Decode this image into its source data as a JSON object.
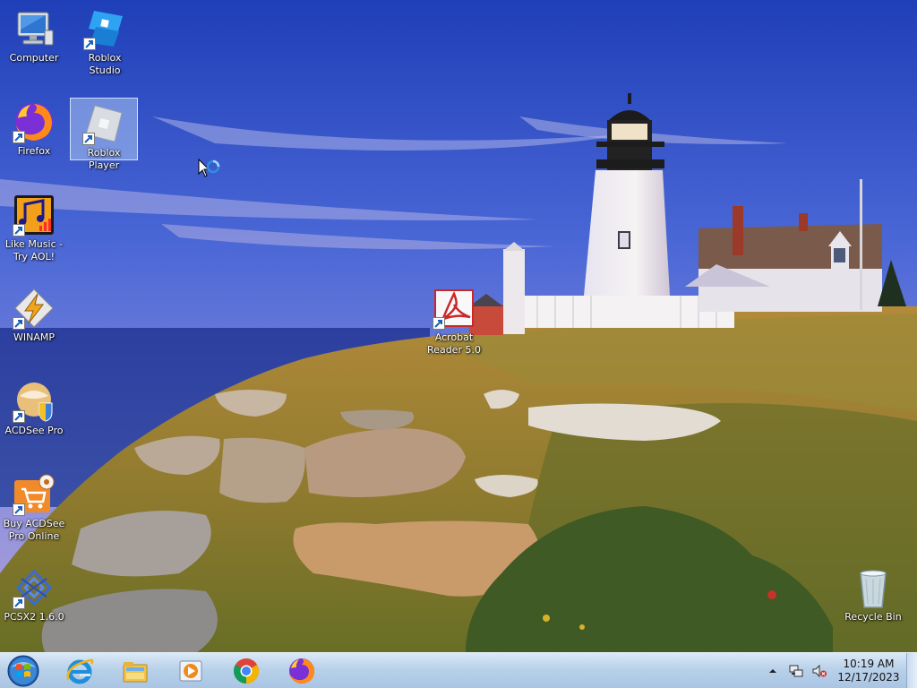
{
  "desktop": {
    "icons": [
      {
        "label": "Computer",
        "icon": "computer-icon"
      },
      {
        "label": "Roblox Studio",
        "icon": "roblox-studio-icon"
      },
      {
        "label": "Firefox",
        "icon": "firefox-icon"
      },
      {
        "label": "Roblox Player",
        "icon": "roblox-player-icon"
      },
      {
        "label": "Like Music - Try AOL!",
        "icon": "like-music-icon"
      },
      {
        "label": "WINAMP",
        "icon": "winamp-icon"
      },
      {
        "label": "ACDSee Pro",
        "icon": "acdsee-icon"
      },
      {
        "label": "Buy ACDSee Pro Online",
        "icon": "buy-acdsee-icon"
      },
      {
        "label": "PCSX2 1.6.0",
        "icon": "pcsx2-icon"
      },
      {
        "label": "Acrobat Reader 5.0",
        "icon": "acrobat-icon"
      },
      {
        "label": "Recycle Bin",
        "icon": "recycle-bin-icon"
      }
    ],
    "selected_icon": "Roblox Player"
  },
  "taskbar": {
    "start": "start-orb-icon",
    "pinned": [
      "internet-explorer-icon",
      "file-explorer-icon",
      "media-player-icon",
      "chrome-icon",
      "firefox-icon"
    ],
    "tray": {
      "icons": [
        "show-hidden-icons-chevron",
        "network-icon",
        "volume-muted-icon"
      ],
      "time": "10:19 AM",
      "date": "12/17/2023"
    }
  },
  "colors": {
    "taskbar_top": "#dbe9f7",
    "taskbar_bottom": "#a9c5e4",
    "icon_label": "#ffffff"
  }
}
